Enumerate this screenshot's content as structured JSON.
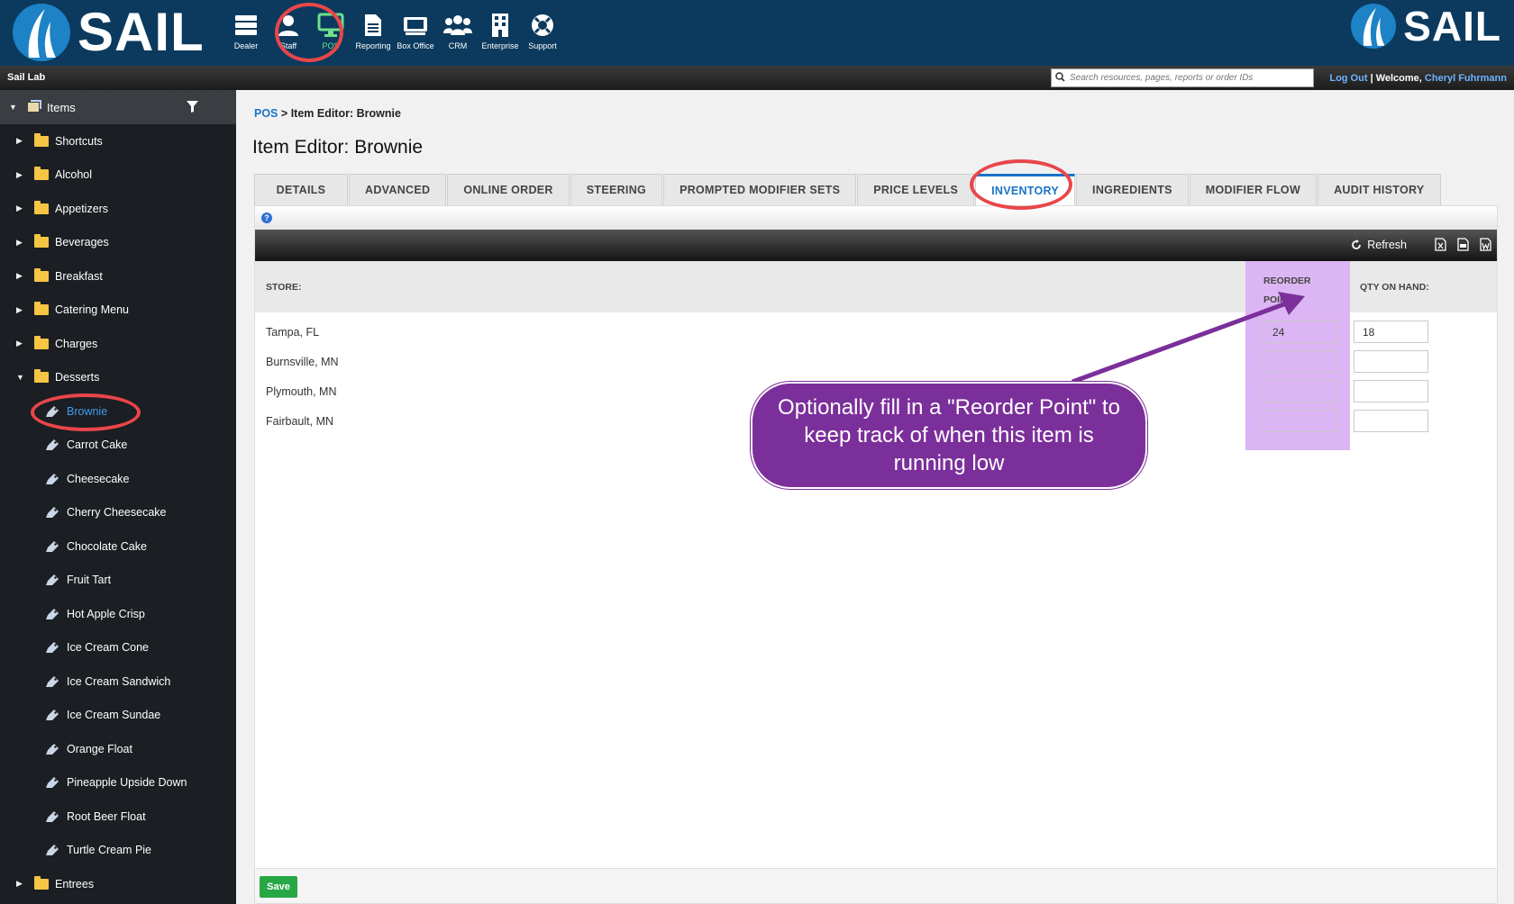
{
  "brand": {
    "name": "SAIL"
  },
  "nav": [
    {
      "label": "Dealer",
      "icon": "server-icon"
    },
    {
      "label": "Staff",
      "icon": "user-icon"
    },
    {
      "label": "POS",
      "icon": "monitor-icon",
      "active": true
    },
    {
      "label": "Reporting",
      "icon": "document-icon"
    },
    {
      "label": "Box Office",
      "icon": "ticket-icon"
    },
    {
      "label": "CRM",
      "icon": "people-icon"
    },
    {
      "label": "Enterprise",
      "icon": "building-icon"
    },
    {
      "label": "Support",
      "icon": "lifebuoy-icon"
    }
  ],
  "subbar": {
    "location": "Sail Lab",
    "search_placeholder": "Search resources, pages, reports or order IDs",
    "logout": "Log Out",
    "separator": "|",
    "welcome": "Welcome,",
    "user": "Cheryl Fuhrmann"
  },
  "sidebar": {
    "root": "Items",
    "folders_top": [
      "Shortcuts",
      "Alcohol",
      "Appetizers",
      "Beverages",
      "Breakfast",
      "Catering Menu",
      "Charges"
    ],
    "open_folder": "Desserts",
    "items": [
      "Brownie",
      "Carrot Cake",
      "Cheesecake",
      "Cherry Cheesecake",
      "Chocolate Cake",
      "Fruit Tart",
      "Hot Apple Crisp",
      "Ice Cream Cone",
      "Ice Cream Sandwich",
      "Ice Cream Sundae",
      "Orange Float",
      "Pineapple Upside Down",
      "Root Beer Float",
      "Turtle Cream Pie"
    ],
    "selected_item": "Brownie",
    "folders_bottom": [
      "Entrees"
    ]
  },
  "breadcrumb": {
    "root": "POS",
    "separator": ">",
    "current": "Item Editor: Brownie"
  },
  "page_title": "Item Editor: Brownie",
  "tabs": [
    "DETAILS",
    "ADVANCED",
    "ONLINE ORDER",
    "STEERING",
    "PROMPTED MODIFIER SETS",
    "PRICE LEVELS",
    "INVENTORY",
    "INGREDIENTS",
    "MODIFIER FLOW",
    "AUDIT HISTORY"
  ],
  "active_tab": "INVENTORY",
  "help_symbol": "?",
  "toolbar": {
    "refresh": "Refresh"
  },
  "grid": {
    "headers": {
      "store": "STORE:",
      "reorder_line1": "REORDER",
      "reorder_line2": "POINT:",
      "qty": "QTY ON HAND:"
    },
    "rows": [
      {
        "store": "Tampa, FL",
        "reorder": "24",
        "qty": "18"
      },
      {
        "store": "Burnsville, MN",
        "reorder": "",
        "qty": ""
      },
      {
        "store": "Plymouth, MN",
        "reorder": "",
        "qty": ""
      },
      {
        "store": "Fairbault, MN",
        "reorder": "",
        "qty": ""
      }
    ]
  },
  "save_label": "Save",
  "callout": "Optionally fill in a \"Reorder Point\" to keep track of when this item is running low",
  "colors": {
    "header": "#0b3a5e",
    "accent": "#1a73c8",
    "highlight": "#dcb6f4",
    "callout": "#7b2f9a",
    "annotation_ring": "#e9464a",
    "save": "#28a745"
  }
}
